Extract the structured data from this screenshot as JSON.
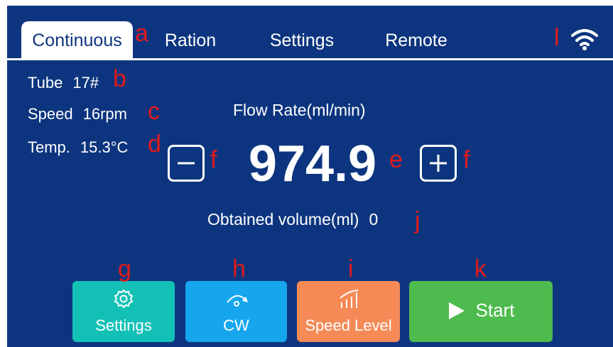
{
  "tabs": [
    {
      "label": "Continuous",
      "active": true
    },
    {
      "label": "Ration",
      "active": false
    },
    {
      "label": "Settings",
      "active": false
    },
    {
      "label": "Remote",
      "active": false
    }
  ],
  "status": {
    "wifi_icon": "wifi-icon"
  },
  "info": {
    "tube": {
      "label": "Tube",
      "value": "17#"
    },
    "speed": {
      "label": "Speed",
      "value": "16rpm"
    },
    "temp": {
      "label": "Temp.",
      "value": "15.3°C"
    }
  },
  "flow": {
    "title": "Flow Rate(ml/min)",
    "value": "974.9"
  },
  "obtained": {
    "label": "Obtained volume(ml)",
    "value": "0"
  },
  "buttons": {
    "settings": {
      "label": "Settings",
      "icon": "gear-icon"
    },
    "cw": {
      "label": "CW",
      "icon": "rotate-cw-icon"
    },
    "speed_level": {
      "label": "Speed Level",
      "icon": "speed-level-icon"
    },
    "start": {
      "label": "Start",
      "icon": "play-icon"
    }
  },
  "annotations": {
    "a": "a",
    "b": "b",
    "c": "c",
    "d": "d",
    "e": "e",
    "f1": "f",
    "f2": "f",
    "g": "g",
    "h": "h",
    "i": "i",
    "j": "j",
    "k": "k",
    "l": "l"
  },
  "colors": {
    "background": "#0d357f",
    "settings_button": "#13c0b6",
    "cw_button": "#15a6ee",
    "speed_button": "#f58a57",
    "start_button": "#4dbb4d",
    "annotation": "#e11b1b"
  }
}
